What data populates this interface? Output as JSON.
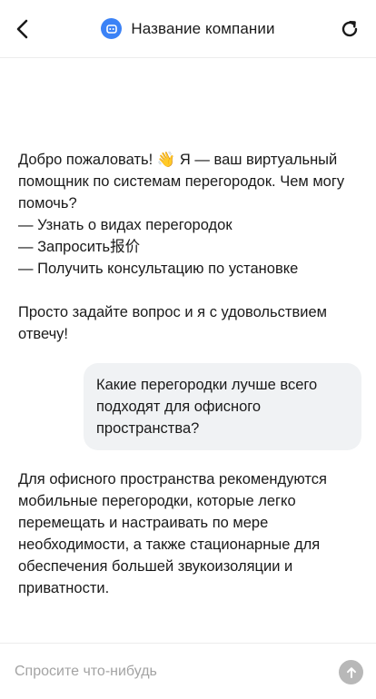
{
  "header": {
    "company_name": "Название компании",
    "back_icon": "chevron-left-icon",
    "refresh_icon": "refresh-icon",
    "logo_icon": "bot-icon",
    "logo_color": "#3b82f6"
  },
  "messages": {
    "greeting": {
      "line1": "Добро пожаловать! 👋 Я — ваш виртуальный помощник по системам перегородок. Чем могу помочь?",
      "option1": "— Узнать о видах перегородок",
      "option2": "— Запросить报价",
      "option3": "— Получить консультацию по установке",
      "closing": "Просто задайте вопрос и я с удовольствием отвечу!"
    },
    "user_question": "Какие перегородки лучше всего подходят для офисного пространства?",
    "assistant_answer": "Для офисного пространства рекомендуются мобильные перегородки, которые легко перемещать и настраивать по мере необходимости, а также стационарные для обеспечения большей звукоизоляции и приватности."
  },
  "composer": {
    "placeholder": "Спросите что-нибудь",
    "value": "",
    "send_icon": "arrow-up-icon"
  }
}
